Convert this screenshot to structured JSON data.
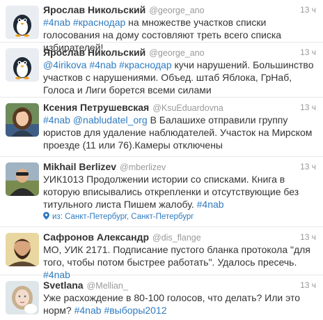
{
  "tweets": [
    {
      "name": "Ярослав Никольский",
      "handle": "@george_ano",
      "time": "13 ч",
      "avatar_icon": "egg-penguin-avatar",
      "text": [
        {
          "t": "tag",
          "v": "#4nab"
        },
        {
          "t": "text",
          "v": " "
        },
        {
          "t": "tag",
          "v": "#краснодар"
        },
        {
          "t": "text",
          "v": " на множестве участков списки голосования на дому состовляют треть всего списка избирателей!"
        }
      ]
    },
    {
      "name": "Ярослав Никольский",
      "handle": "@george_ano",
      "time": "13 ч",
      "avatar_icon": "egg-penguin-avatar",
      "text": [
        {
          "t": "mention",
          "v": "@4irikova"
        },
        {
          "t": "text",
          "v": " "
        },
        {
          "t": "tag",
          "v": "#4nab"
        },
        {
          "t": "text",
          "v": " "
        },
        {
          "t": "tag",
          "v": "#краснодар"
        },
        {
          "t": "text",
          "v": " кучи нарушений. Большинство участков с нарушениями. Объед. штаб Яблока, ГрНаб, Голоса и Лиги борется всеми силами"
        }
      ]
    },
    {
      "name": "Ксения Петрушевская",
      "handle": "@KsuEduardovna",
      "time": "13 ч",
      "avatar_icon": "woman-photo-avatar",
      "text": [
        {
          "t": "tag",
          "v": "#4nab"
        },
        {
          "t": "text",
          "v": " "
        },
        {
          "t": "mention",
          "v": "@nabludatel_org"
        },
        {
          "t": "text",
          "v": " В Балашихе отправили группу юристов для удаление наблюдателей. Участок на Мирском проезде (11 или 76).Камеры отключены"
        }
      ]
    },
    {
      "name": "Mikhail Berlizev",
      "handle": "@mberlizev",
      "time": "13 ч",
      "avatar_icon": "man-photo-avatar",
      "text": [
        {
          "t": "text",
          "v": "УИК1013 Продолжении истории со списками. Книга в которую вписывались открепленки и отсутствующие без титульного листа Пишем жалобу. "
        },
        {
          "t": "tag",
          "v": "#4nab"
        }
      ],
      "geo": "из: Санкт-Петербург, Санкт-Петербург"
    },
    {
      "name": "Сафронов Александр",
      "handle": "@dis_flange",
      "time": "13 ч",
      "avatar_icon": "man-beard-avatar",
      "text": [
        {
          "t": "text",
          "v": "МО, УИК 2171. Подписание пустого бланка протокола \"для того, чтобы потом быстрее работать\". Удалось пресечь. "
        },
        {
          "t": "tag",
          "v": "#4nab"
        }
      ]
    },
    {
      "name": "Svetlana",
      "handle": "@Mellian_",
      "time": "13 ч",
      "avatar_icon": "girl-photo-avatar",
      "text": [
        {
          "t": "text",
          "v": "Уже расхождение в 80-100 голосов, что делать? Или это норм? "
        },
        {
          "t": "tag",
          "v": "#4nab"
        },
        {
          "t": "text",
          "v": " "
        },
        {
          "t": "tag",
          "v": "#выборы2012"
        }
      ]
    }
  ],
  "colors": {
    "link": "#2f7bc1",
    "meta": "#999999",
    "text": "#333333"
  }
}
